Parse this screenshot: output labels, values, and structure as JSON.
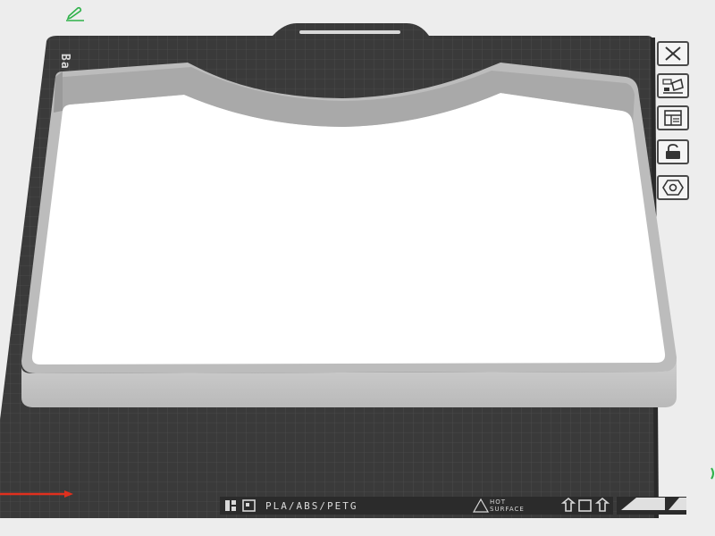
{
  "plate": {
    "name_tag": "Ba",
    "material_label": "PLA/ABS/PETG",
    "hot_surface": [
      "HOT",
      "SURFACE"
    ]
  },
  "toolbar": {
    "items": [
      {
        "icon": "close-icon",
        "label": ""
      },
      {
        "icon": "auto-orient-icon",
        "label": ""
      },
      {
        "icon": "arrange-icon",
        "label": ""
      },
      {
        "icon": "lock-icon",
        "label": ""
      },
      {
        "icon": "plate-settings-icon",
        "label": ""
      }
    ]
  },
  "colors": {
    "background": "#ededed",
    "plate": "#3b3b3b",
    "grid": "#6a6a6a",
    "model_top": "#ffffff",
    "model_wall": "#c4c4c4",
    "x_axis": "#e0301e",
    "pen_accent": "#2fb24a"
  }
}
